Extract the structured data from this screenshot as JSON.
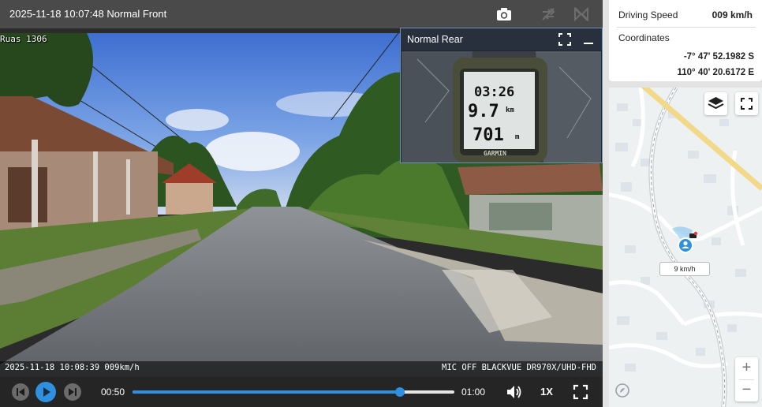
{
  "player": {
    "title": "2025-11-18 10:07:48 Normal Front",
    "road_name": "Ruas 1306",
    "osd_left": "2025-11-18 10:08:39 009km/h",
    "osd_right": "MIC OFF BLACKVUE DR970X/UHD-FHD",
    "icons": [
      "camera-icon",
      "swap-camera-icon",
      "flip-icon"
    ]
  },
  "pip": {
    "title": "Normal Rear",
    "gps_time": "03:26",
    "gps_distance": "9.7",
    "gps_distance_unit": "km",
    "gps_elevation": "701",
    "gps_elevation_unit": "m",
    "gps_brand": "GARMIN"
  },
  "controls": {
    "current_time": "00:50",
    "end_time": "01:00",
    "progress": 0.83,
    "playback_speed": "1X",
    "accent_color": "#2f8fe0"
  },
  "info": {
    "driving_speed_label": "Driving Speed",
    "driving_speed_value": "009 km/h",
    "coordinates_label": "Coordinates",
    "latitude": "-7° 47' 52.1982 S",
    "longitude": "110° 40' 20.6172 E"
  },
  "map": {
    "speed_tag": "9 km/h",
    "zoom_in": "+",
    "zoom_out": "−"
  }
}
